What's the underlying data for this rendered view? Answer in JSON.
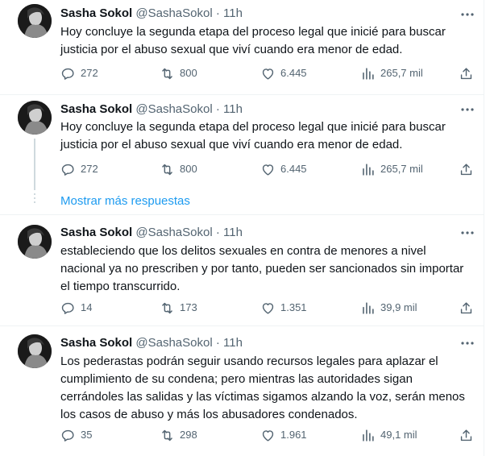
{
  "tweets": [
    {
      "name": "Sasha Sokol",
      "handle": "@SashaSokol",
      "separator": "·",
      "time": "11h",
      "text": "Hoy concluye la segunda etapa del proceso legal que inicié para buscar justicia por el abuso sexual que viví cuando era menor de edad.",
      "replies": "272",
      "retweets": "800",
      "likes": "6.445",
      "views": "265,7 mil"
    },
    {
      "name": "Sasha Sokol",
      "handle": "@SashaSokol",
      "separator": "·",
      "time": "11h",
      "text": "Hoy concluye la segunda etapa del proceso legal que inicié para buscar justicia por el abuso sexual que viví cuando era menor de edad.",
      "replies": "272",
      "retweets": "800",
      "likes": "6.445",
      "views": "265,7 mil"
    },
    {
      "name": "Sasha Sokol",
      "handle": "@SashaSokol",
      "separator": "·",
      "time": "11h",
      "text": "estableciendo que los delitos sexuales en contra de menores a nivel nacional ya no prescriben y por tanto, pueden ser sancionados sin importar el tiempo transcurrido.",
      "replies": "14",
      "retweets": "173",
      "likes": "1.351",
      "views": "39,9 mil"
    },
    {
      "name": "Sasha Sokol",
      "handle": "@SashaSokol",
      "separator": "·",
      "time": "11h",
      "text": "Los pederastas podrán seguir usando recursos legales para aplazar el cumplimiento de su condena; pero mientras las autoridades sigan cerrándoles las salidas y las víctimas sigamos alzando la voz, serán menos los casos de abuso y más los abusadores condenados.",
      "replies": "35",
      "retweets": "298",
      "likes": "1.961",
      "views": "49,1 mil"
    }
  ],
  "show_more_replies": "Mostrar más respuestas",
  "icons": {
    "more": "more-horizontal-icon",
    "reply": "reply-icon",
    "retweet": "retweet-icon",
    "like": "heart-icon",
    "views": "views-bar-chart-icon",
    "share": "share-icon"
  },
  "colors": {
    "text": "#0f1419",
    "secondary": "#536471",
    "link": "#1d9bf0",
    "border": "#eff3f4"
  }
}
